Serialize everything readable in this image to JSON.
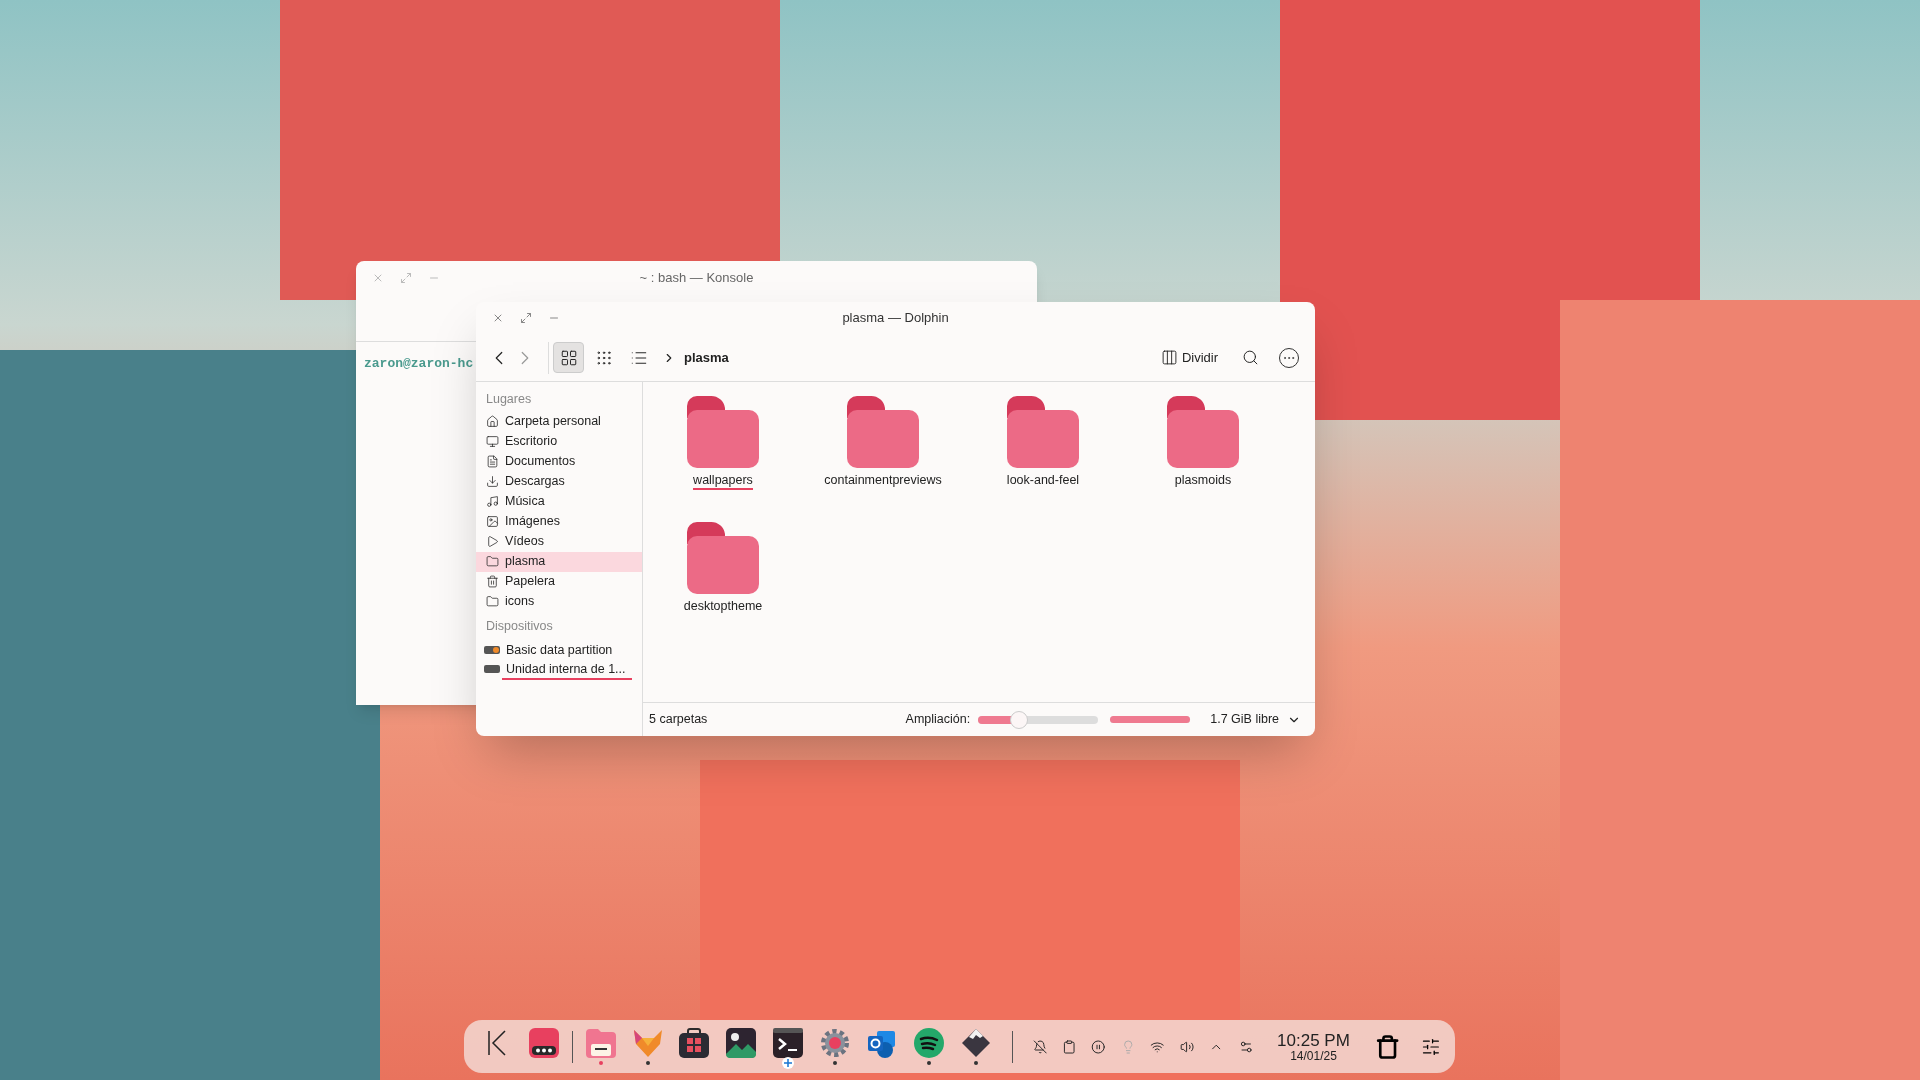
{
  "konsole": {
    "title": "~ : bash — Konsole",
    "prompt": "zaron@zaron-hc"
  },
  "dolphin": {
    "title": "plasma — Dolphin",
    "toolbar": {
      "views": [
        {
          "kind": "icons",
          "selected": true
        },
        {
          "kind": "compact",
          "selected": false
        },
        {
          "kind": "details",
          "selected": false
        }
      ],
      "breadcrumb": "plasma",
      "split": "Dividir"
    },
    "sidebar": {
      "places_title": "Lugares",
      "places": [
        {
          "kind": "home",
          "label": "Carpeta personal",
          "selected": false
        },
        {
          "kind": "desktop",
          "label": "Escritorio",
          "selected": false
        },
        {
          "kind": "documents",
          "label": "Documentos",
          "selected": false
        },
        {
          "kind": "downloads",
          "label": "Descargas",
          "selected": false
        },
        {
          "kind": "music",
          "label": "Música",
          "selected": false
        },
        {
          "kind": "pictures",
          "label": "Imágenes",
          "selected": false
        },
        {
          "kind": "videos",
          "label": "Vídeos",
          "selected": false
        },
        {
          "kind": "folder",
          "label": "plasma",
          "selected": true
        },
        {
          "kind": "trash",
          "label": "Papelera",
          "selected": false
        },
        {
          "kind": "folder",
          "label": "icons",
          "selected": false
        }
      ],
      "devices_title": "Dispositivos",
      "devices": [
        {
          "kind": "partition",
          "label": "Basic data partition"
        },
        {
          "kind": "drive",
          "label": "Unidad interna de 1...",
          "level": 1
        }
      ]
    },
    "folders": [
      {
        "name": "wallpapers",
        "focused": true
      },
      {
        "name": "containmentpreviews",
        "focused": false
      },
      {
        "name": "look-and-feel",
        "focused": false
      },
      {
        "name": "plasmoids",
        "focused": false
      },
      {
        "name": "desktoptheme",
        "focused": false
      }
    ],
    "status_bar": {
      "count": "5 carpetas",
      "zoom_label": "Ampliación:",
      "zoom": {
        "level": 0.34
      },
      "space": {
        "level": 1
      },
      "free": "1.7 GiB libre"
    }
  },
  "dock": {
    "apps": [
      {
        "kind": "launcher",
        "running": false,
        "active": false
      },
      {
        "kind": "overview",
        "running": false,
        "active": false
      },
      {
        "kind": "files",
        "running": true,
        "active": true
      },
      {
        "kind": "fox",
        "running": true,
        "active": false
      },
      {
        "kind": "store",
        "running": false,
        "active": false
      },
      {
        "kind": "images",
        "running": false,
        "active": false
      },
      {
        "kind": "terminal",
        "running": false,
        "active": false
      },
      {
        "kind": "settings",
        "running": true,
        "active": false
      },
      {
        "kind": "mail",
        "running": false,
        "active": false
      },
      {
        "kind": "music",
        "running": true,
        "active": false
      },
      {
        "kind": "diamond",
        "running": true,
        "active": false
      }
    ],
    "tray": [
      {
        "kind": "bell-off"
      },
      {
        "kind": "clipboard"
      },
      {
        "kind": "pause"
      },
      {
        "kind": "bulb"
      },
      {
        "kind": "wifi"
      },
      {
        "kind": "volume"
      },
      {
        "kind": "chevron"
      },
      {
        "kind": "network"
      }
    ],
    "time": "10:25 PM",
    "date": "14/01/25"
  }
}
